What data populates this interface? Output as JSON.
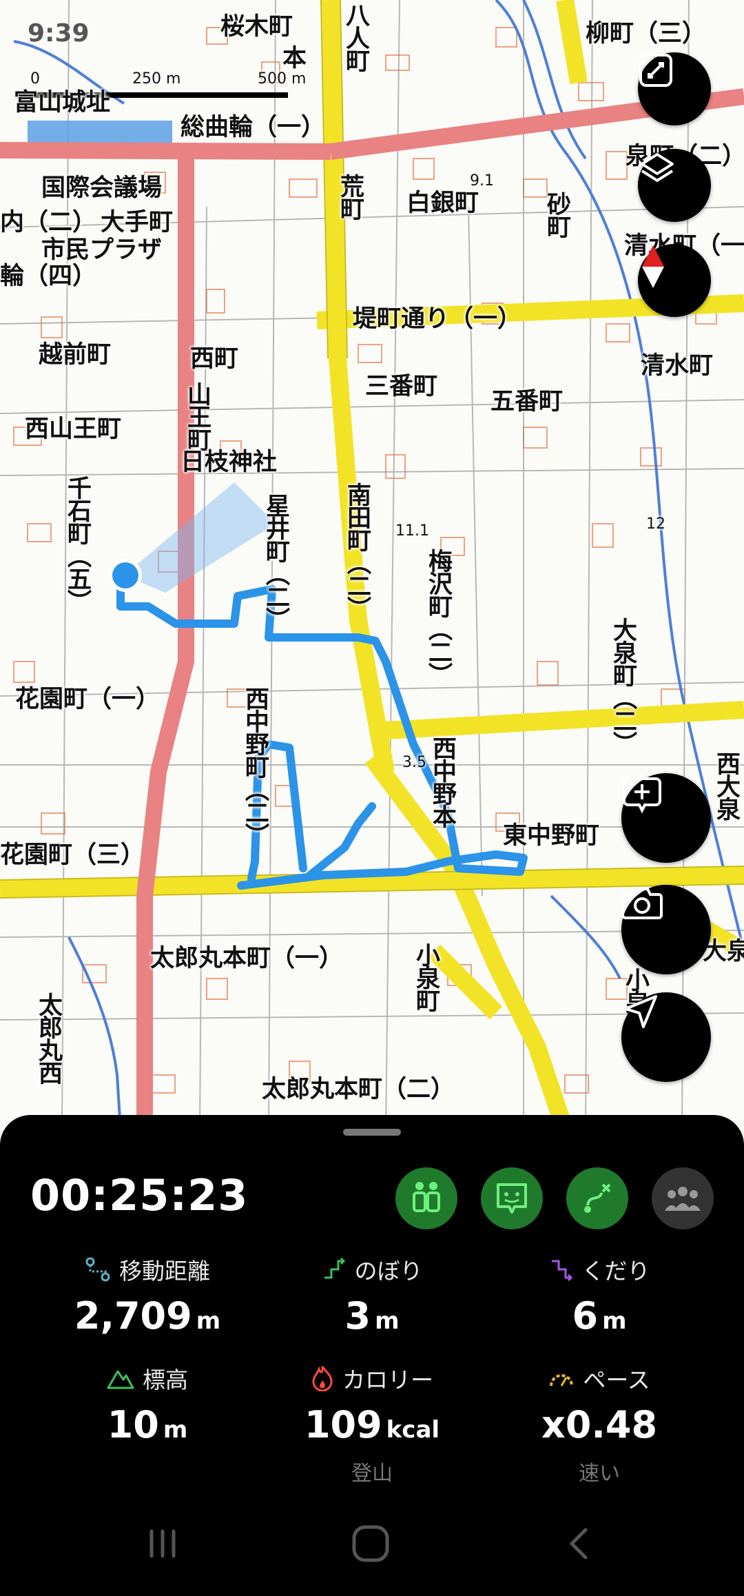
{
  "status_bar": {
    "time": "9:39"
  },
  "map": {
    "scale": {
      "zero": "0",
      "mid": "250 m",
      "end": "500 m"
    },
    "labels": {
      "sakuragi": "桜木町",
      "hon": "本",
      "hachininmachi": "八人町",
      "yanagi": "柳町（三）",
      "fukuyama_castle": "富山城址",
      "sokyokuwa1": "総曲輪（一）",
      "kokusai": "国際会議場",
      "izumi2": "泉町（二）",
      "hachi91": "9.1",
      "arama": "荒町",
      "shiroganemachi": "白銀町",
      "sunamachi": "砂町",
      "uchi2": "内（二）",
      "otemachi": "大手町",
      "shimin": "市民プラザ",
      "shimizu_top": "清水町（一",
      "wa4": "輪（四）",
      "tsutsumi1": "堤町通り（一）",
      "echizen": "越前町",
      "nishimachi": "西町",
      "shimizucho": "清水町",
      "sanbancho": "三番町",
      "gobancho": "五番町",
      "nishisanno": "西山王町",
      "sannomachi": "山王町",
      "hie_shrine": "日枝神社",
      "hoshii": "星井町（二）",
      "minamida": "南田町（二）",
      "h111": "11.1",
      "h12": "12",
      "sengoku": "千石町（五）",
      "umezawa": "梅沢町（二）",
      "oizumi2": "大泉町（二）",
      "hanazono1": "花園町（一）",
      "nishinakano2": "西中野町（二）",
      "nishinakanohon": "西中野本",
      "h35": "3.5",
      "nishioizumi": "西大泉",
      "higashinakano": "東中野町",
      "hanazono3": "花園町（三）",
      "taromaru1": "太郎丸本町（一）",
      "koizumi": "小泉町",
      "taromaru_nishi": "太郎丸西",
      "taromaru2": "太郎丸本町（二）",
      "oizumi_right": "大泉",
      "koizumi_r": "小泉"
    }
  },
  "fabs": [
    {
      "name": "fullscreen-icon"
    },
    {
      "name": "layers-icon"
    },
    {
      "name": "compass-icon"
    },
    {
      "name": "add-comment-icon"
    },
    {
      "name": "camera-icon"
    },
    {
      "name": "navigate-icon"
    }
  ],
  "activity": {
    "timer": "00:25:23",
    "actions": [
      {
        "name": "companions-icon",
        "color": "#1f7a2c"
      },
      {
        "name": "trail-report-icon",
        "color": "#1f7a2c"
      },
      {
        "name": "route-icon",
        "color": "#1f7a2c"
      },
      {
        "name": "group-icon",
        "color": "#333333"
      }
    ],
    "stats": {
      "distance": {
        "label": "移動距離",
        "value": "2,709",
        "unit": "m",
        "icon": "distance-icon",
        "color": "#5ab4c8"
      },
      "ascent": {
        "label": "のぼり",
        "value": "3",
        "unit": "m",
        "icon": "ascent-icon",
        "color": "#3bbf5f"
      },
      "descent": {
        "label": "くだり",
        "value": "6",
        "unit": "m",
        "icon": "descent-icon",
        "color": "#a855e8"
      },
      "altitude": {
        "label": "標高",
        "value": "10",
        "unit": "m",
        "icon": "mountain-icon",
        "color": "#3bbf5f"
      },
      "calorie": {
        "label": "カロリー",
        "value": "109",
        "unit": "kcal",
        "icon": "flame-icon",
        "color": "#ff4a3a",
        "sub": "登山"
      },
      "pace": {
        "label": "ペース",
        "value": "x0.48",
        "unit": "",
        "icon": "speedometer-icon",
        "color": "#f0b429",
        "sub": "速い"
      }
    }
  },
  "nav_bar": {
    "recent": "recent-apps-icon",
    "home": "home-icon",
    "back": "back-icon"
  }
}
